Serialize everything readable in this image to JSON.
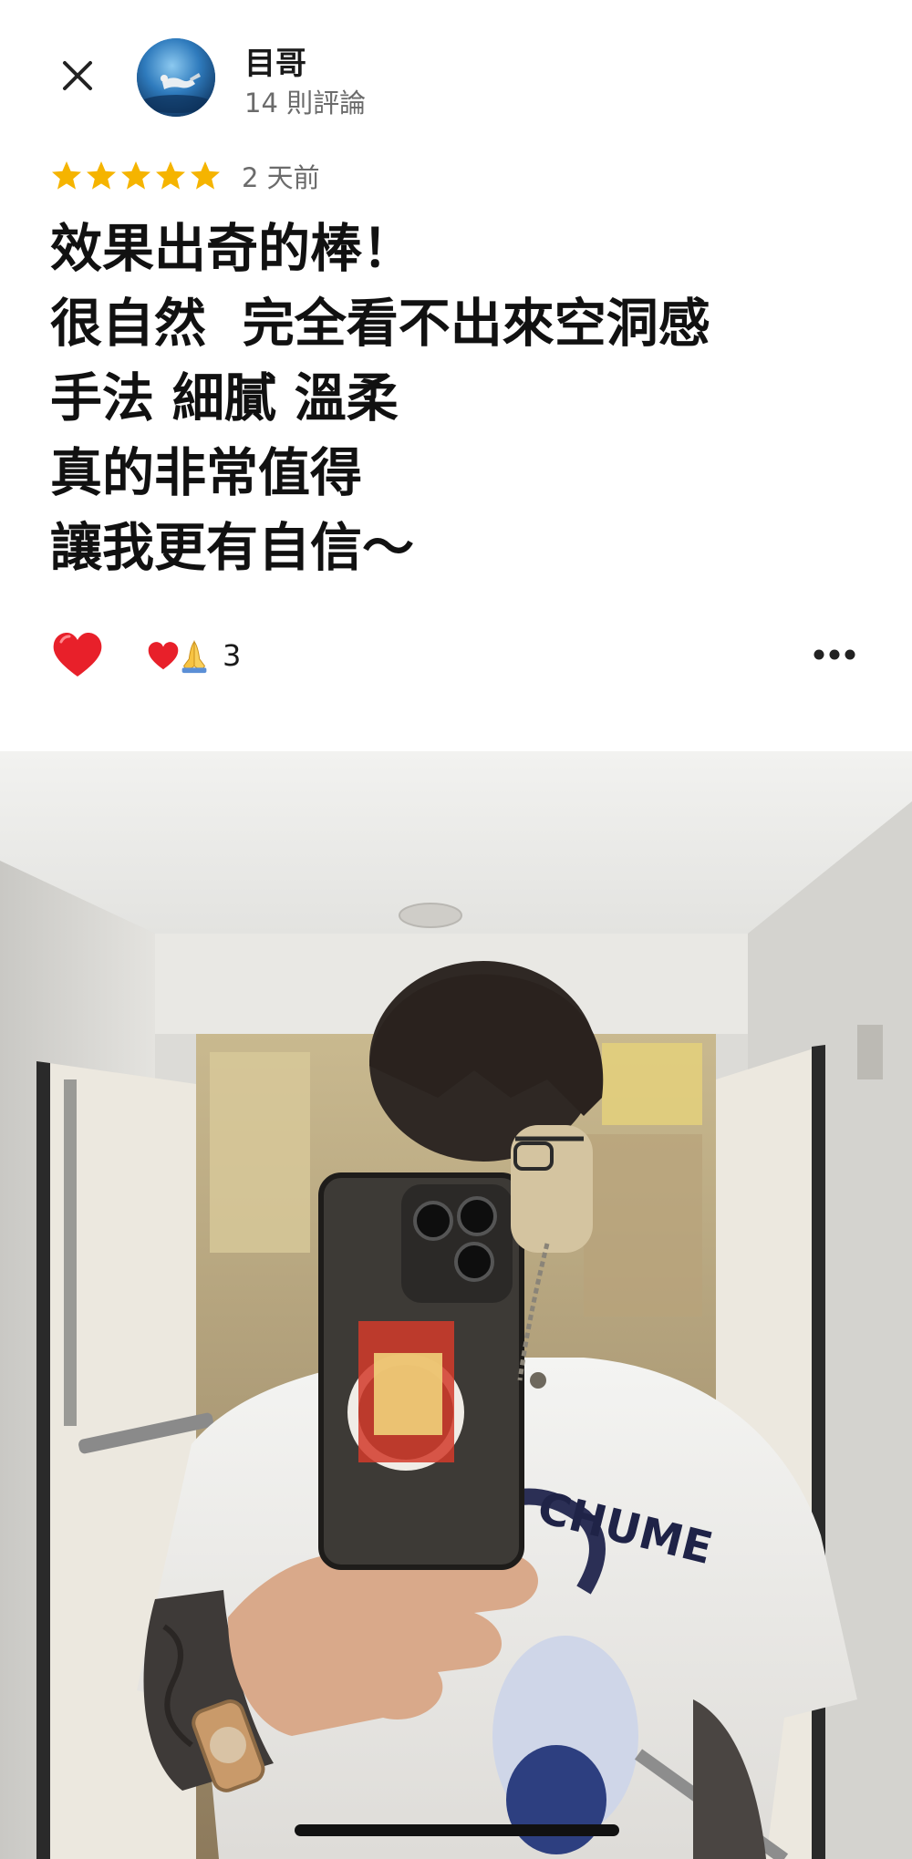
{
  "header": {
    "close_icon": "close-icon",
    "avatar_icon": "avatar-diver-photo",
    "reviewer_name": "目哥",
    "review_count": "14 則評論"
  },
  "rating": {
    "stars": 5,
    "star_color": "#F5B400",
    "time_ago": "2 天前"
  },
  "review": {
    "lines": [
      "效果出奇的棒！",
      "很自然  完全看不出來空洞感",
      "手法 細膩 溫柔",
      "真的非常值得",
      "讓我更有自信～"
    ]
  },
  "reactions": {
    "like_icon": "heart-icon",
    "like_color": "#E8202A",
    "summary_icons": [
      "heart-icon",
      "folded-hands-icon"
    ],
    "count": "3",
    "more_icon": "more-horizontal-icon"
  },
  "photo": {
    "description_icon": "review-photo",
    "tshirt_text": "CHUME"
  }
}
